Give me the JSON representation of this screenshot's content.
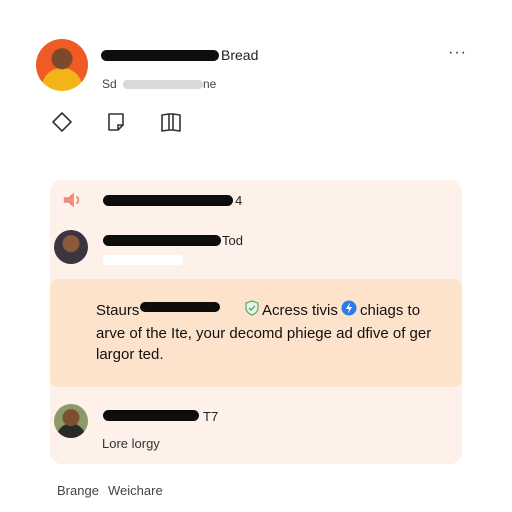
{
  "header": {
    "name_suffix": "Bread",
    "sub_left": "Sd",
    "sub_right": "ne",
    "more_label": "···"
  },
  "actions": {
    "icons": [
      "diamond-icon",
      "note-icon",
      "book-icon"
    ]
  },
  "feed": {
    "row1": {
      "count": "4"
    },
    "row2": {
      "name_suffix": "Tod"
    },
    "status": {
      "label": "Staurs",
      "right_text": "Acress tivis",
      "right_text2": "chiags to",
      "line2": "arve of the Ite, your decomd phiege ad dfive of ger",
      "line3": "largor ted."
    },
    "row3": {
      "count": "T7",
      "text": "Lore lorgy"
    }
  },
  "footer": {
    "left": "Brange",
    "right": "Weichare"
  },
  "colors": {
    "card_bg": "#fdf1e9",
    "status_bg": "#fde2cc",
    "accent_blue": "#2b7de9",
    "accent_green": "#5aa86b"
  }
}
